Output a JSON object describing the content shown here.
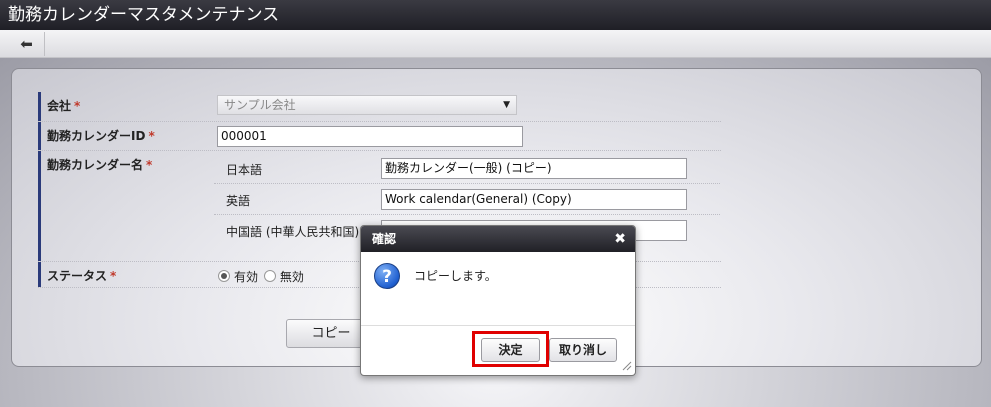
{
  "window": {
    "title": "勤務カレンダーマスタメンテナンス"
  },
  "toolbar": {
    "back_icon": "arrow-left-icon"
  },
  "form": {
    "company": {
      "label": "会社",
      "required_mark": "*",
      "value": "サンプル会社"
    },
    "calendar_id": {
      "label": "勤務カレンダーID",
      "required_mark": "*",
      "value": "000001"
    },
    "calendar_name": {
      "label": "勤務カレンダー名",
      "required_mark": "*",
      "locales": [
        {
          "label": "日本語",
          "value": "勤務カレンダー(一般) (コピー)"
        },
        {
          "label": "英語",
          "value": "Work calendar(General) (Copy)"
        },
        {
          "label": "中国語 (中華人民共和国)",
          "value": ""
        }
      ]
    },
    "status": {
      "label": "ステータス",
      "required_mark": "*",
      "options": [
        "有効",
        "無効"
      ],
      "selected": "有効"
    },
    "copy_button": "コピー"
  },
  "dialog": {
    "title": "確認",
    "close_icon": "close-icon",
    "message_icon": "question-icon",
    "message": "コピーします。",
    "ok_button": "決定",
    "cancel_button": "取り消し"
  }
}
